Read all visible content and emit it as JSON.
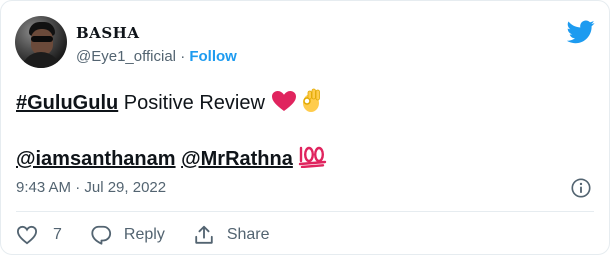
{
  "author": {
    "display_name": "BASHA",
    "handle": "@Eye1_official",
    "separator": "·",
    "follow_label": "Follow"
  },
  "tweet": {
    "hashtag": "#GuluGulu",
    "text_after_hashtag": " Positive Review ",
    "emojis_line1": [
      "heart",
      "ok-hand"
    ],
    "mention1": "@iamsanthanam",
    "mention2": "@MrRathna",
    "emoji_line2": "hundred-points",
    "timestamp": "9:43 AM · Jul 29, 2022"
  },
  "actions": {
    "like_count": "7",
    "reply_label": "Reply",
    "share_label": "Share"
  },
  "colors": {
    "accent": "#1d9bf0",
    "text": "#0f1419",
    "muted": "#536471",
    "heart": "#e0245e"
  }
}
